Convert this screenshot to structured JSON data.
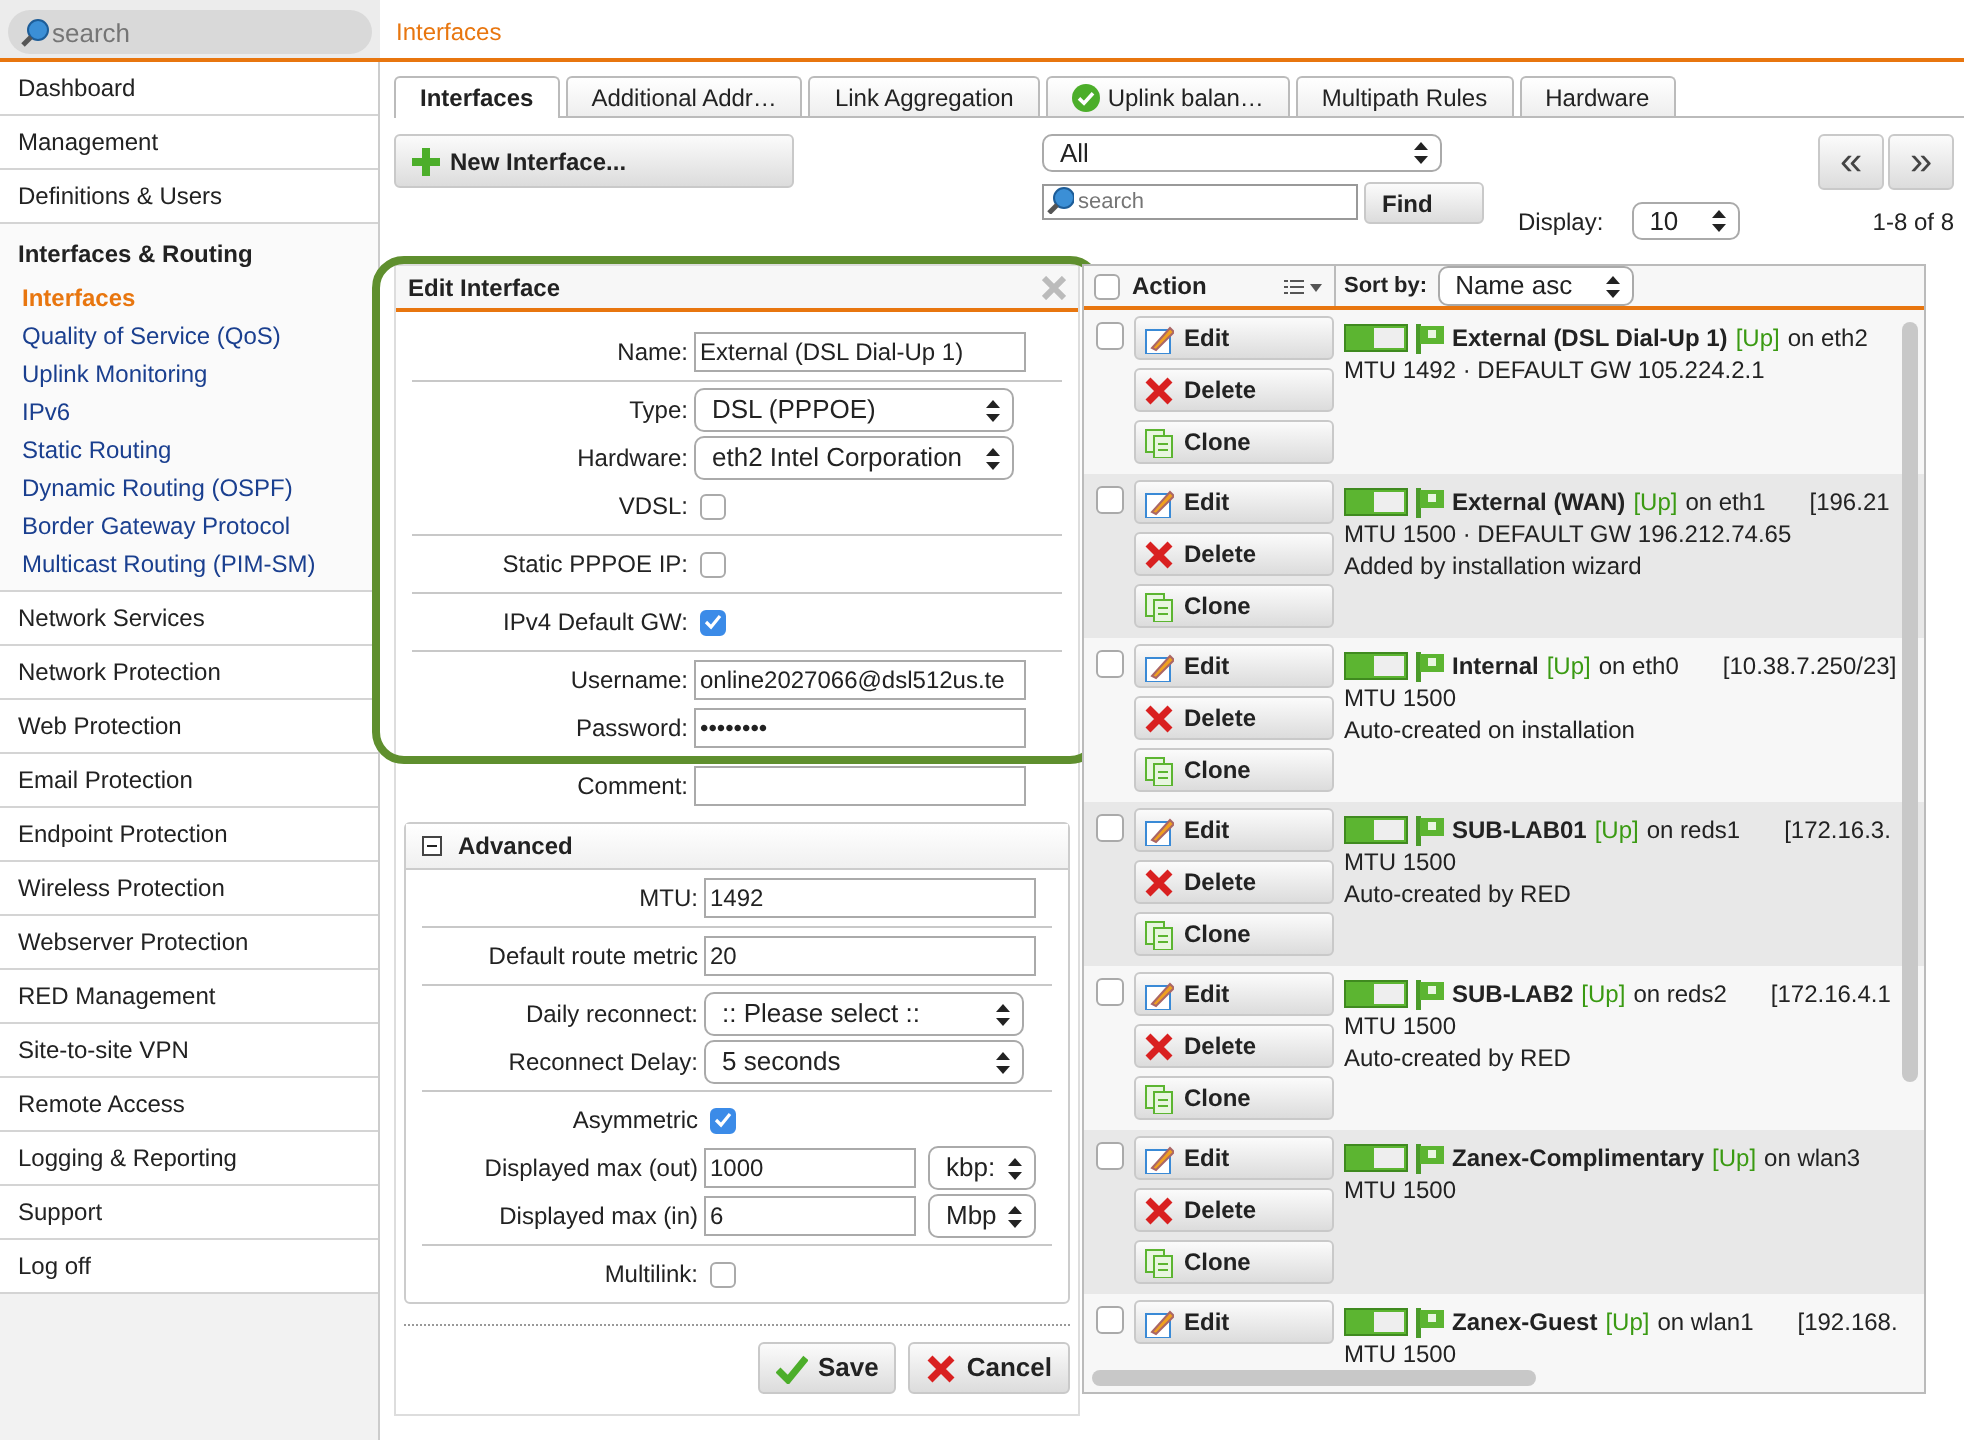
{
  "sidebar": {
    "search": {
      "placeholder": "search"
    },
    "items": [
      {
        "label": "Dashboard"
      },
      {
        "label": "Management"
      },
      {
        "label": "Definitions & Users"
      },
      {
        "label": "Interfaces & Routing",
        "expanded": true,
        "children": [
          {
            "label": "Interfaces",
            "selected": true
          },
          {
            "label": "Quality of Service (QoS)",
            "selected": false
          },
          {
            "label": "Uplink Monitoring",
            "selected": false
          },
          {
            "label": "IPv6",
            "selected": false
          },
          {
            "label": "Static Routing",
            "selected": false
          },
          {
            "label": "Dynamic Routing (OSPF)",
            "selected": false
          },
          {
            "label": "Border Gateway Protocol",
            "selected": false
          },
          {
            "label": "Multicast Routing (PIM-SM)",
            "selected": false
          }
        ]
      },
      {
        "label": "Network Services"
      },
      {
        "label": "Network Protection"
      },
      {
        "label": "Web Protection"
      },
      {
        "label": "Email Protection"
      },
      {
        "label": "Endpoint Protection"
      },
      {
        "label": "Wireless Protection"
      },
      {
        "label": "Webserver Protection"
      },
      {
        "label": "RED Management"
      },
      {
        "label": "Site-to-site VPN"
      },
      {
        "label": "Remote Access"
      },
      {
        "label": "Logging & Reporting"
      },
      {
        "label": "Support"
      },
      {
        "label": "Log off"
      }
    ]
  },
  "page_title": "Interfaces",
  "tabs": [
    {
      "label": "Interfaces",
      "selected": true,
      "kind": "plain"
    },
    {
      "label": "Additional Addr…",
      "selected": false,
      "kind": "plain"
    },
    {
      "label": "Link Aggregation",
      "selected": false,
      "kind": "plain"
    },
    {
      "label": "Uplink balan…",
      "selected": false,
      "kind": "ok"
    },
    {
      "label": "Multipath Rules",
      "selected": false,
      "kind": "plain"
    },
    {
      "label": "Hardware",
      "selected": false,
      "kind": "plain"
    }
  ],
  "toolbar": {
    "new_button": "New Interface...",
    "filter": "All",
    "search_placeholder": "search",
    "find_button": "Find",
    "pager": [
      "«",
      "»"
    ],
    "display_label": "Display:",
    "display_value": "10",
    "range": "1-8 of 8"
  },
  "dialog": {
    "title": "Edit Interface",
    "groups": [
      [
        {
          "kind": "text",
          "label": "Name:",
          "value": "External (DSL Dial-Up 1)"
        }
      ],
      [
        {
          "kind": "select",
          "label": "Type:",
          "value": "DSL (PPPOE)"
        },
        {
          "kind": "select",
          "label": "Hardware:",
          "value": "eth2 Intel Corporation"
        },
        {
          "kind": "checkbox",
          "label": "VDSL:",
          "checked": false
        }
      ],
      [
        {
          "kind": "checkbox",
          "label": "Static PPPOE IP:",
          "checked": false
        }
      ],
      [
        {
          "kind": "checkbox",
          "label": "IPv4 Default GW:",
          "checked": true
        }
      ],
      [
        {
          "kind": "text",
          "label": "Username:",
          "value": "online2027066@dsl512us.te"
        },
        {
          "kind": "text",
          "label": "Password:",
          "value": "••••••••"
        }
      ],
      [
        {
          "kind": "text",
          "label": "Comment:"
        }
      ]
    ],
    "advanced": {
      "title": "Advanced",
      "expanded": true,
      "groups": [
        [
          {
            "kind": "text",
            "label": "MTU:",
            "value": "1492"
          }
        ],
        [
          {
            "kind": "text",
            "label": "Default route metric",
            "value": "20"
          }
        ],
        [
          {
            "kind": "select",
            "label": "Daily reconnect:",
            "value": ":: Please select ::"
          },
          {
            "kind": "select",
            "label": "Reconnect Delay:",
            "value": "5 seconds"
          }
        ],
        [
          {
            "kind": "checkbox",
            "label": "Asymmetric",
            "checked": true
          },
          {
            "kind": "unit",
            "label": "Displayed max (out)",
            "value": "1000",
            "unit": "kbp:"
          },
          {
            "kind": "unit",
            "label": "Displayed max (in)",
            "value": "6",
            "unit": "Mbp"
          }
        ],
        [
          {
            "kind": "checkbox",
            "label": "Multilink:",
            "checked": false
          }
        ]
      ]
    },
    "buttons": [
      {
        "kind": "save",
        "label": "Save"
      },
      {
        "kind": "cancel",
        "label": "Cancel"
      }
    ]
  },
  "list": {
    "select_all_checked": false,
    "action_header": "Action",
    "sort_label": "Sort by:",
    "sort_value": "Name asc",
    "rows": [
      {
        "name": "External (DSL Dial-Up 1)",
        "status": "[Up]",
        "iface": "on eth2",
        "checked": false,
        "enabled": true,
        "details": [
          "MTU 1492 · DEFAULT GW 105.224.2.1"
        ],
        "actions": [
          {
            "kind": "edit",
            "label": "Edit"
          },
          {
            "kind": "delete",
            "label": "Delete"
          },
          {
            "kind": "clone",
            "label": "Clone"
          }
        ]
      },
      {
        "name": "External (WAN)",
        "status": "[Up]",
        "iface": "on eth1",
        "address": "[196.21",
        "checked": false,
        "enabled": true,
        "details": [
          "MTU 1500 · DEFAULT GW 196.212.74.65",
          "Added by installation wizard"
        ],
        "actions": [
          {
            "kind": "edit",
            "label": "Edit"
          },
          {
            "kind": "delete",
            "label": "Delete"
          },
          {
            "kind": "clone",
            "label": "Clone"
          }
        ]
      },
      {
        "name": "Internal",
        "status": "[Up]",
        "iface": "on eth0",
        "address": "[10.38.7.250/23]",
        "checked": false,
        "enabled": true,
        "details": [
          "MTU 1500",
          "Auto-created on installation"
        ],
        "actions": [
          {
            "kind": "edit",
            "label": "Edit"
          },
          {
            "kind": "delete",
            "label": "Delete"
          },
          {
            "kind": "clone",
            "label": "Clone"
          }
        ]
      },
      {
        "name": "SUB-LAB01",
        "status": "[Up]",
        "iface": "on reds1",
        "address": "[172.16.3.",
        "checked": false,
        "enabled": true,
        "details": [
          "MTU 1500",
          "Auto-created by RED"
        ],
        "actions": [
          {
            "kind": "edit",
            "label": "Edit"
          },
          {
            "kind": "delete",
            "label": "Delete"
          },
          {
            "kind": "clone",
            "label": "Clone"
          }
        ]
      },
      {
        "name": "SUB-LAB2",
        "status": "[Up]",
        "iface": "on reds2",
        "address": "[172.16.4.1",
        "checked": false,
        "enabled": true,
        "details": [
          "MTU 1500",
          "Auto-created by RED"
        ],
        "actions": [
          {
            "kind": "edit",
            "label": "Edit"
          },
          {
            "kind": "delete",
            "label": "Delete"
          },
          {
            "kind": "clone",
            "label": "Clone"
          }
        ]
      },
      {
        "name": "Zanex-Complimentary",
        "status": "[Up]",
        "iface": "on wlan3",
        "checked": false,
        "enabled": true,
        "details": [
          "MTU 1500"
        ],
        "actions": [
          {
            "kind": "edit",
            "label": "Edit"
          },
          {
            "kind": "delete",
            "label": "Delete"
          },
          {
            "kind": "clone",
            "label": "Clone"
          }
        ]
      },
      {
        "name": "Zanex-Guest",
        "status": "[Up]",
        "iface": "on wlan1",
        "address": "[192.168.",
        "checked": false,
        "enabled": true,
        "details": [
          "MTU 1500"
        ],
        "actions": [
          {
            "kind": "edit",
            "label": "Edit"
          }
        ]
      }
    ]
  }
}
